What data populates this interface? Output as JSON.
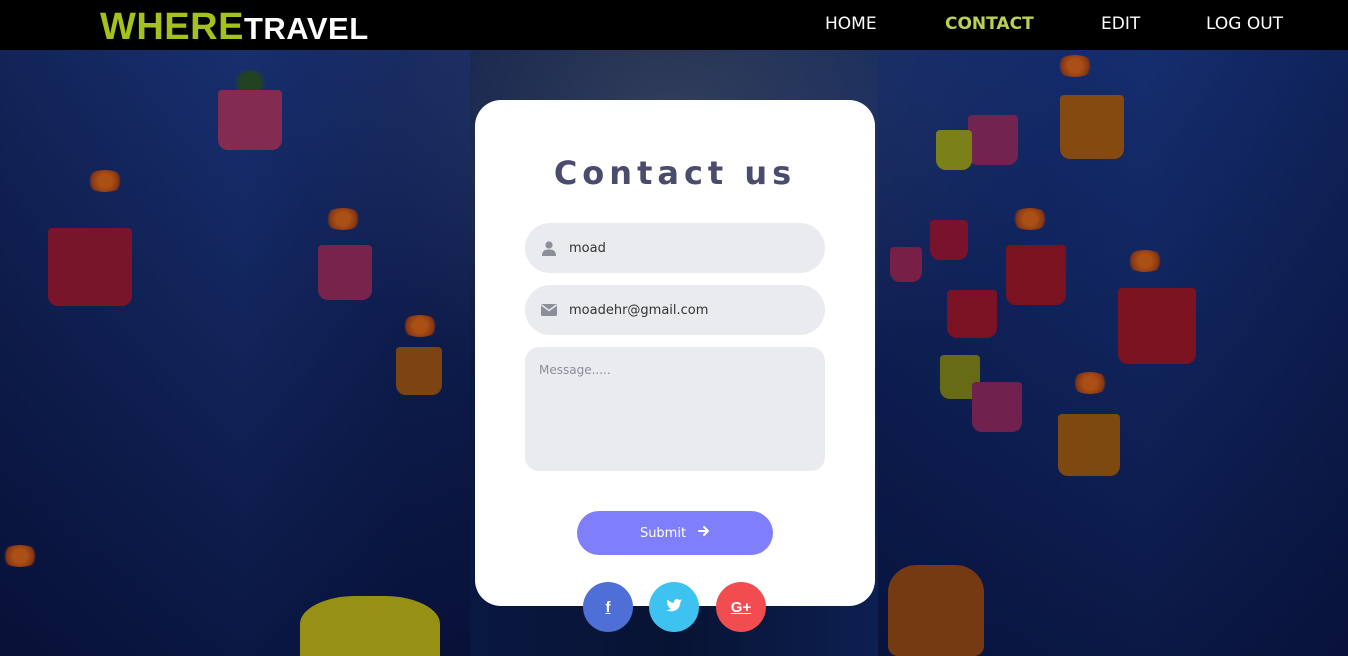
{
  "brand": {
    "part1": "WHERE",
    "part2": "TRAVEL"
  },
  "nav": {
    "items": [
      {
        "label": "HOME",
        "active": false
      },
      {
        "label": "CONTACT",
        "active": true
      },
      {
        "label": "EDIT",
        "active": false
      },
      {
        "label": "LOG OUT",
        "active": false
      }
    ]
  },
  "form": {
    "title": "Contact us",
    "name_value": "moad",
    "email_value": "moadehr@gmail.com",
    "message_placeholder": "Message.....",
    "submit_label": "Submit"
  },
  "social": {
    "facebook": "f",
    "google_plus": "G+"
  },
  "colors": {
    "brand_green": "#a3c21c",
    "nav_active": "#b9d255",
    "submit": "#7f7ffb",
    "facebook": "#4e6fd6",
    "twitter": "#3ec3f1",
    "google_plus": "#f14d50",
    "title": "#4b4b6e"
  },
  "icons": {
    "name_field": "user-icon",
    "email_field": "envelope-icon",
    "submit": "arrow-right-icon",
    "twitter": "twitter-icon"
  }
}
